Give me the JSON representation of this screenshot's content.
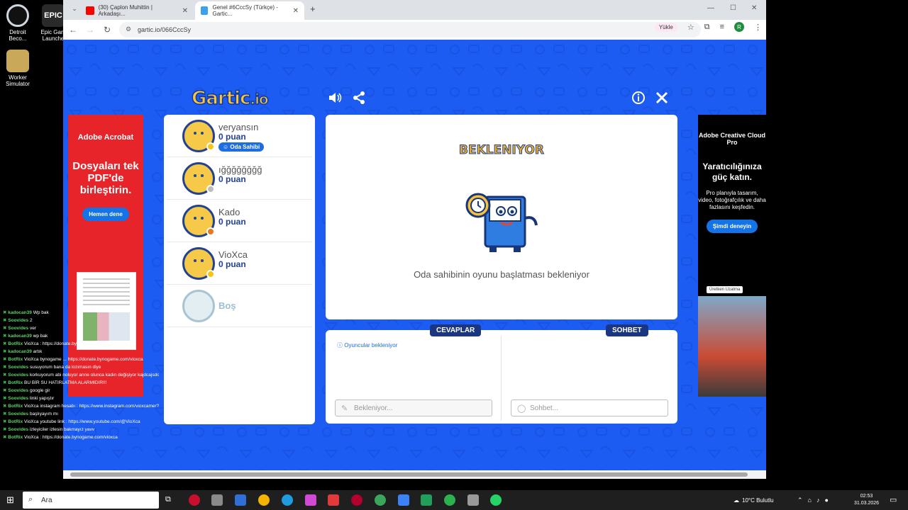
{
  "desktop": {
    "icons": [
      {
        "label": "Detroit Beco...",
        "color": "#2b2b2b"
      },
      {
        "label": "Epic Gam Launche",
        "color": "#2b2b2b"
      },
      {
        "label": "Worker Simulator",
        "color": "#caa85a"
      }
    ]
  },
  "browser": {
    "tabs": [
      {
        "title": "(30) Çaplon Muhittin | Arkadaşı...",
        "favicon_color": "#ff0000"
      },
      {
        "title": "Genel #6CccSy (Türkçe) - Gartic...",
        "favicon_color": "#3aa0f0"
      }
    ],
    "new_tab": "+",
    "url": "gartic.io/066CccSy",
    "upload_label": "Yükle",
    "profile_initial": "R"
  },
  "game": {
    "logo": "Gartic",
    "logo_suffix": ".io",
    "players": [
      {
        "name": "veryansın",
        "points": "0 puan",
        "badge": "Oda Sahibi",
        "status_color": "#f5c518"
      },
      {
        "name": "ığğğğğğğğ",
        "points": "0 puan",
        "badge": "",
        "status_color": "#bdbdbd"
      },
      {
        "name": "Kado",
        "points": "0 puan",
        "badge": "",
        "status_color": "#e87722"
      },
      {
        "name": "VioXca",
        "points": "0 puan",
        "badge": "",
        "status_color": "#f5c518"
      }
    ],
    "empty_slot": "Boş",
    "status_title": "BEKLENIYOR",
    "status_message": "Oda sahibinin oyunu başlatması bekleniyor",
    "answers_tab": "CEVAPLAR",
    "chat_tab": "SOHBET",
    "answers_info": "Oyuncular bekleniyor",
    "answers_placeholder": "Bekleniyor...",
    "chat_placeholder": "Sohbet..."
  },
  "ads": {
    "left": {
      "brand": "Adobe Acrobat",
      "headline": "Dosyaları tek PDF'de birleştirin.",
      "button": "Hemen dene"
    },
    "right": {
      "brand": "Adobe Creative Cloud Pro",
      "headline": "Yaratıcılığınıza güç katın.",
      "body": "Pro planıyla tasarım, video, fotoğrafçılık ve daha fazlasını keşfedin.",
      "button": "Şimdi deneyin",
      "tag": "Üretken Uzatma"
    }
  },
  "stream_chat": [
    {
      "user": "kadocan39",
      "text": "Wp bak"
    },
    {
      "user": "Soovides",
      "text": "2"
    },
    {
      "user": "Soovides",
      "text": "ver"
    },
    {
      "user": "kadocan39",
      "text": "wp bak"
    },
    {
      "user": "BotRix",
      "text": "VioXca : https://donate.bynogame.com/vioxca"
    },
    {
      "user": "kadocan39",
      "text": "artık"
    },
    {
      "user": "BotRix",
      "text": "VioXca bynogame ... https://donate.bynogame.com/vioxca"
    },
    {
      "user": "Soovides",
      "text": "susuyorum bana da lozımasın diye"
    },
    {
      "user": "Soovides",
      "text": "korkuyorum abi noluyor anne olunca kadın değişiyor kajdcajsdca"
    },
    {
      "user": "BotRix",
      "text": "BU BİR SU HATIRLATMA ALARMIDIR!!!"
    },
    {
      "user": "Soovides",
      "text": "google gir"
    },
    {
      "user": "Soovides",
      "text": "linki yapıştır"
    },
    {
      "user": "BotRix",
      "text": "VioXca instagram hesabı : https://www.instagram.com/vioxcamer?igsh=MXN1bzI1ZjlhwcTg3bA%3D%3D"
    },
    {
      "user": "Soovides",
      "text": "başlıyayım mı"
    },
    {
      "user": "BotRix",
      "text": "VioXca youtube link : https://www.youtube.com/@VioXca"
    },
    {
      "user": "Soovides",
      "text": "izleyiciler izlesin bakmayız yavv"
    },
    {
      "user": "BotRix",
      "text": "VioXca : https://donate.bynogame.com/vioxca"
    }
  ],
  "taskbar": {
    "search_placeholder": "Ara",
    "weather": "10°C  Bulutlu",
    "time": "02:53",
    "date": "31.03.2026"
  }
}
